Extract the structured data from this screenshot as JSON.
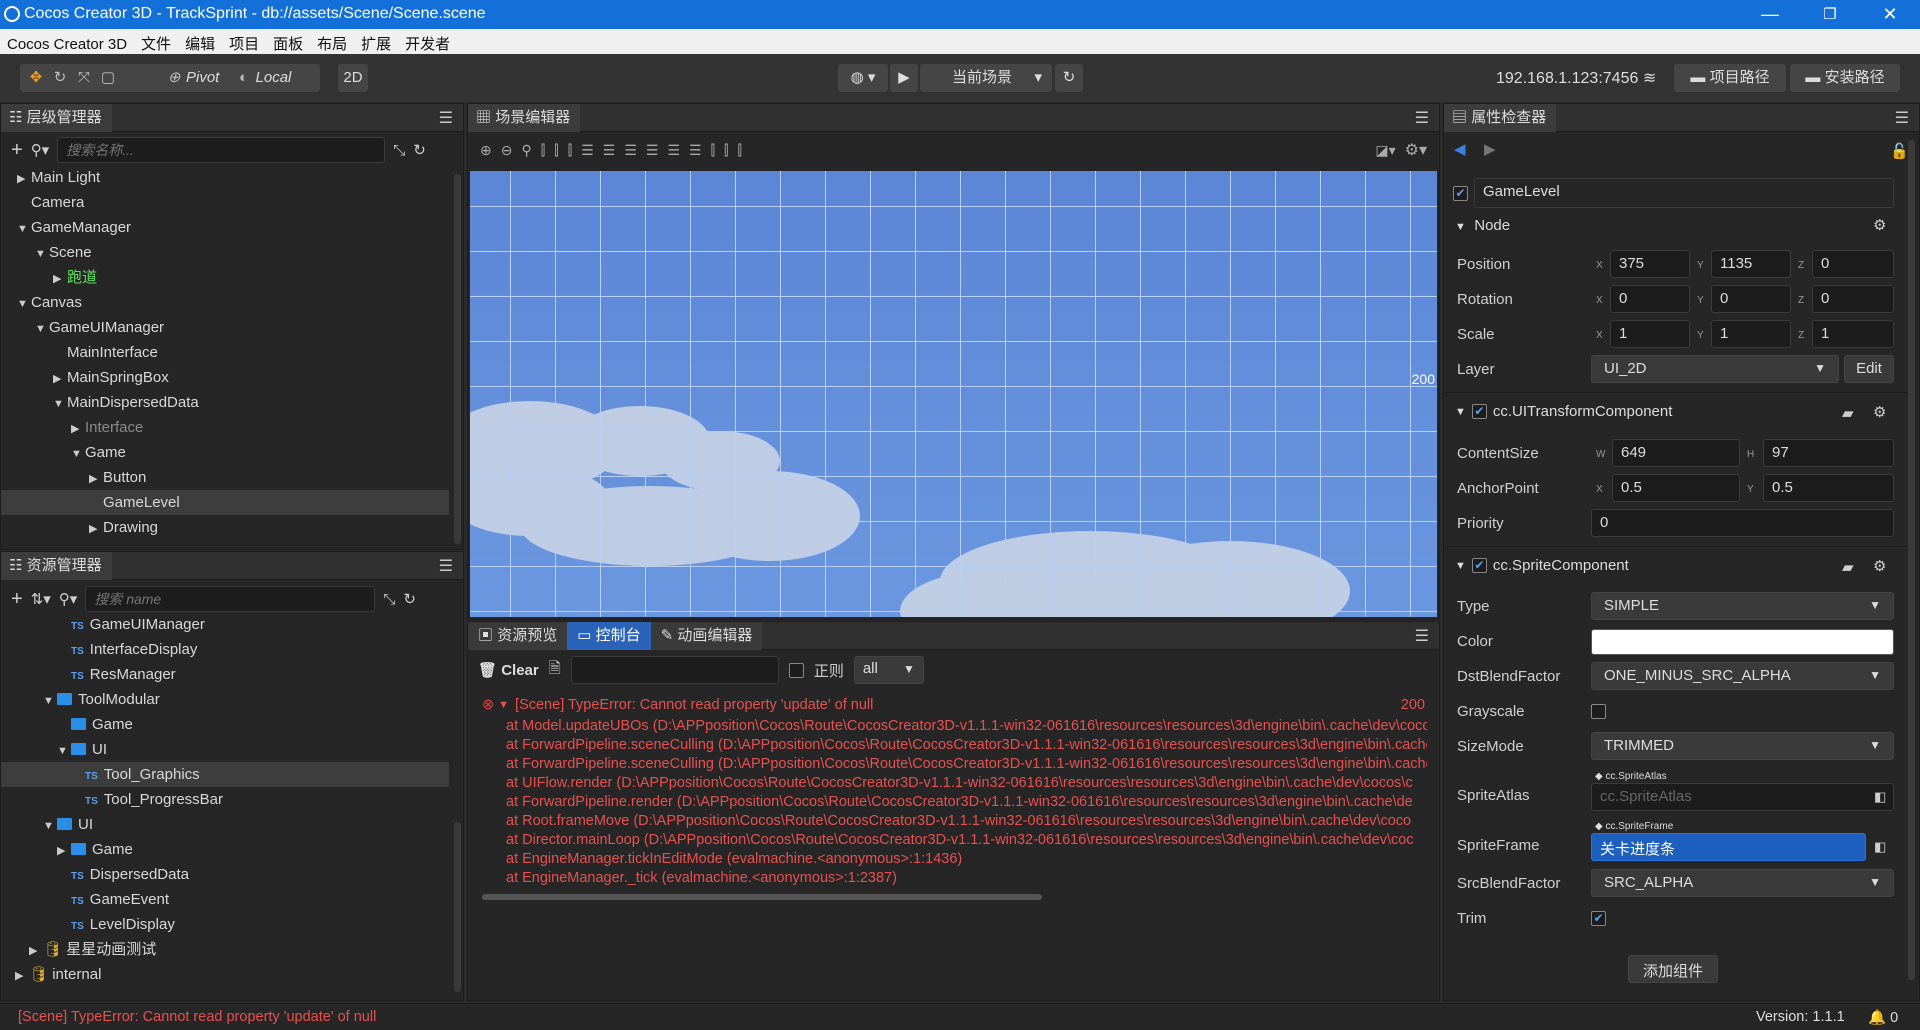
{
  "window": {
    "title": "Cocos Creator 3D - TrackSprint - db://assets/Scene/Scene.scene",
    "minimize": "—",
    "maximize": "❐",
    "close": "✕"
  },
  "menu": [
    "Cocos Creator 3D",
    "文件",
    "编辑",
    "项目",
    "面板",
    "布局",
    "扩展",
    "开发者"
  ],
  "toolbar": {
    "pivot": "Pivot",
    "local": "Local",
    "mode2d": "2D",
    "scene_select": "当前场景",
    "ip": "192.168.1.123:7456",
    "project_path": "项目路径",
    "install_path": "安装路径"
  },
  "hierarchy": {
    "title": "层级管理器",
    "search_placeholder": "搜索名称...",
    "items": [
      {
        "label": "Main Light",
        "indent": 0,
        "tri": "▶"
      },
      {
        "label": "Camera",
        "indent": 0,
        "tri": ""
      },
      {
        "label": "GameManager",
        "indent": 0,
        "tri": "▼"
      },
      {
        "label": "Scene",
        "indent": 1,
        "tri": "▼"
      },
      {
        "label": "跑道",
        "indent": 2,
        "tri": "▶",
        "color": "#5fe05f"
      },
      {
        "label": "Canvas",
        "indent": 0,
        "tri": "▼"
      },
      {
        "label": "GameUIManager",
        "indent": 1,
        "tri": "▼"
      },
      {
        "label": "MainInterface",
        "indent": 2,
        "tri": ""
      },
      {
        "label": "MainSpringBox",
        "indent": 2,
        "tri": "▶"
      },
      {
        "label": "MainDispersedData",
        "indent": 2,
        "tri": "▼"
      },
      {
        "label": "Interface",
        "indent": 3,
        "tri": "▶",
        "color": "#8a8a8a"
      },
      {
        "label": "Game",
        "indent": 3,
        "tri": "▼"
      },
      {
        "label": "Button",
        "indent": 4,
        "tri": "▶"
      },
      {
        "label": "GameLevel",
        "indent": 4,
        "tri": "",
        "sel": true
      },
      {
        "label": "Drawing",
        "indent": 4,
        "tri": "▶"
      }
    ]
  },
  "assets": {
    "title": "资源管理器",
    "search_placeholder": "搜索 name",
    "items": [
      {
        "label": "GameUIManager",
        "indent": 3,
        "kind": "ts"
      },
      {
        "label": "InterfaceDisplay",
        "indent": 3,
        "kind": "ts"
      },
      {
        "label": "ResManager",
        "indent": 3,
        "kind": "ts"
      },
      {
        "label": "ToolModular",
        "indent": 2,
        "kind": "folder",
        "tri": "▼"
      },
      {
        "label": "Game",
        "indent": 3,
        "kind": "folder"
      },
      {
        "label": "UI",
        "indent": 3,
        "kind": "folder",
        "tri": "▼"
      },
      {
        "label": "Tool_Graphics",
        "indent": 4,
        "kind": "ts",
        "sel": true
      },
      {
        "label": "Tool_ProgressBar",
        "indent": 4,
        "kind": "ts"
      },
      {
        "label": "UI",
        "indent": 2,
        "kind": "folder",
        "tri": "▼"
      },
      {
        "label": "Game",
        "indent": 3,
        "kind": "folder",
        "tri": "▶"
      },
      {
        "label": "DispersedData",
        "indent": 3,
        "kind": "ts"
      },
      {
        "label": "GameEvent",
        "indent": 3,
        "kind": "ts"
      },
      {
        "label": "LevelDisplay",
        "indent": 3,
        "kind": "ts"
      },
      {
        "label": "星星动画测试",
        "indent": 1,
        "kind": "db",
        "tri": "▶"
      },
      {
        "label": "internal",
        "indent": 0,
        "kind": "db",
        "tri": "▶"
      }
    ]
  },
  "scene": {
    "title": "场景编辑器",
    "ruler_label": "200"
  },
  "console": {
    "tabs": [
      "资源预览",
      "控制台",
      "动画编辑器"
    ],
    "clear": "Clear",
    "regex": "正则",
    "filter": "all",
    "error_title": "[Scene] TypeError: Cannot read property 'update' of null",
    "error_count": "200",
    "stack": [
      "at Model.updateUBOs (D:\\APPposition\\Cocos\\Route\\CocosCreator3D-v1.1.1-win32-061616\\resources\\resources\\3d\\engine\\bin\\.cache\\dev\\cocos",
      "at ForwardPipeline.sceneCulling (D:\\APPposition\\Cocos\\Route\\CocosCreator3D-v1.1.1-win32-061616\\resources\\resources\\3d\\engine\\bin\\.cache",
      "at ForwardPipeline.sceneCulling (D:\\APPposition\\Cocos\\Route\\CocosCreator3D-v1.1.1-win32-061616\\resources\\resources\\3d\\engine\\bin\\.cache",
      "at UIFlow.render (D:\\APPposition\\Cocos\\Route\\CocosCreator3D-v1.1.1-win32-061616\\resources\\resources\\3d\\engine\\bin\\.cache\\dev\\cocos\\c",
      "at ForwardPipeline.render (D:\\APPposition\\Cocos\\Route\\CocosCreator3D-v1.1.1-win32-061616\\resources\\resources\\3d\\engine\\bin\\.cache\\de",
      "at Root.frameMove (D:\\APPposition\\Cocos\\Route\\CocosCreator3D-v1.1.1-win32-061616\\resources\\resources\\3d\\engine\\bin\\.cache\\dev\\coco",
      "at Director.mainLoop (D:\\APPposition\\Cocos\\Route\\CocosCreator3D-v1.1.1-win32-061616\\resources\\resources\\3d\\engine\\bin\\.cache\\dev\\coc",
      "at EngineManager.tickInEditMode (evalmachine.<anonymous>:1:1436)",
      "at EngineManager._tick (evalmachine.<anonymous>:1:2387)"
    ]
  },
  "inspector": {
    "title": "属性检查器",
    "node_name": "GameLevel",
    "node_section": "Node",
    "position": {
      "label": "Position",
      "x": "375",
      "y": "1135",
      "z": "0"
    },
    "rotation": {
      "label": "Rotation",
      "x": "0",
      "y": "0",
      "z": "0"
    },
    "scale": {
      "label": "Scale",
      "x": "1",
      "y": "1",
      "z": "1"
    },
    "layer": {
      "label": "Layer",
      "value": "UI_2D",
      "edit": "Edit"
    },
    "uitransform": {
      "title": "cc.UITransformComponent",
      "content_label": "ContentSize",
      "w": "649",
      "h": "97",
      "anchor_label": "AnchorPoint",
      "ax": "0.5",
      "ay": "0.5",
      "priority_label": "Priority",
      "priority": "0"
    },
    "sprite": {
      "title": "cc.SpriteComponent",
      "type_label": "Type",
      "type": "SIMPLE",
      "color_label": "Color",
      "color": "#ffffff",
      "dst_label": "DstBlendFactor",
      "dst": "ONE_MINUS_SRC_ALPHA",
      "gray_label": "Grayscale",
      "size_label": "SizeMode",
      "size": "TRIMMED",
      "atlas_label": "SpriteAtlas",
      "atlas_tag": "cc.SpriteAtlas",
      "atlas_placeholder": "cc.SpriteAtlas",
      "frame_label": "SpriteFrame",
      "frame_tag": "cc.SpriteFrame",
      "frame": "关卡进度条",
      "src_label": "SrcBlendFactor",
      "src": "SRC_ALPHA",
      "trim_label": "Trim"
    },
    "add_component": "添加组件"
  },
  "status": {
    "error": "[Scene] TypeError: Cannot read property 'update' of null",
    "version": "Version: 1.1.1",
    "count": "0"
  }
}
